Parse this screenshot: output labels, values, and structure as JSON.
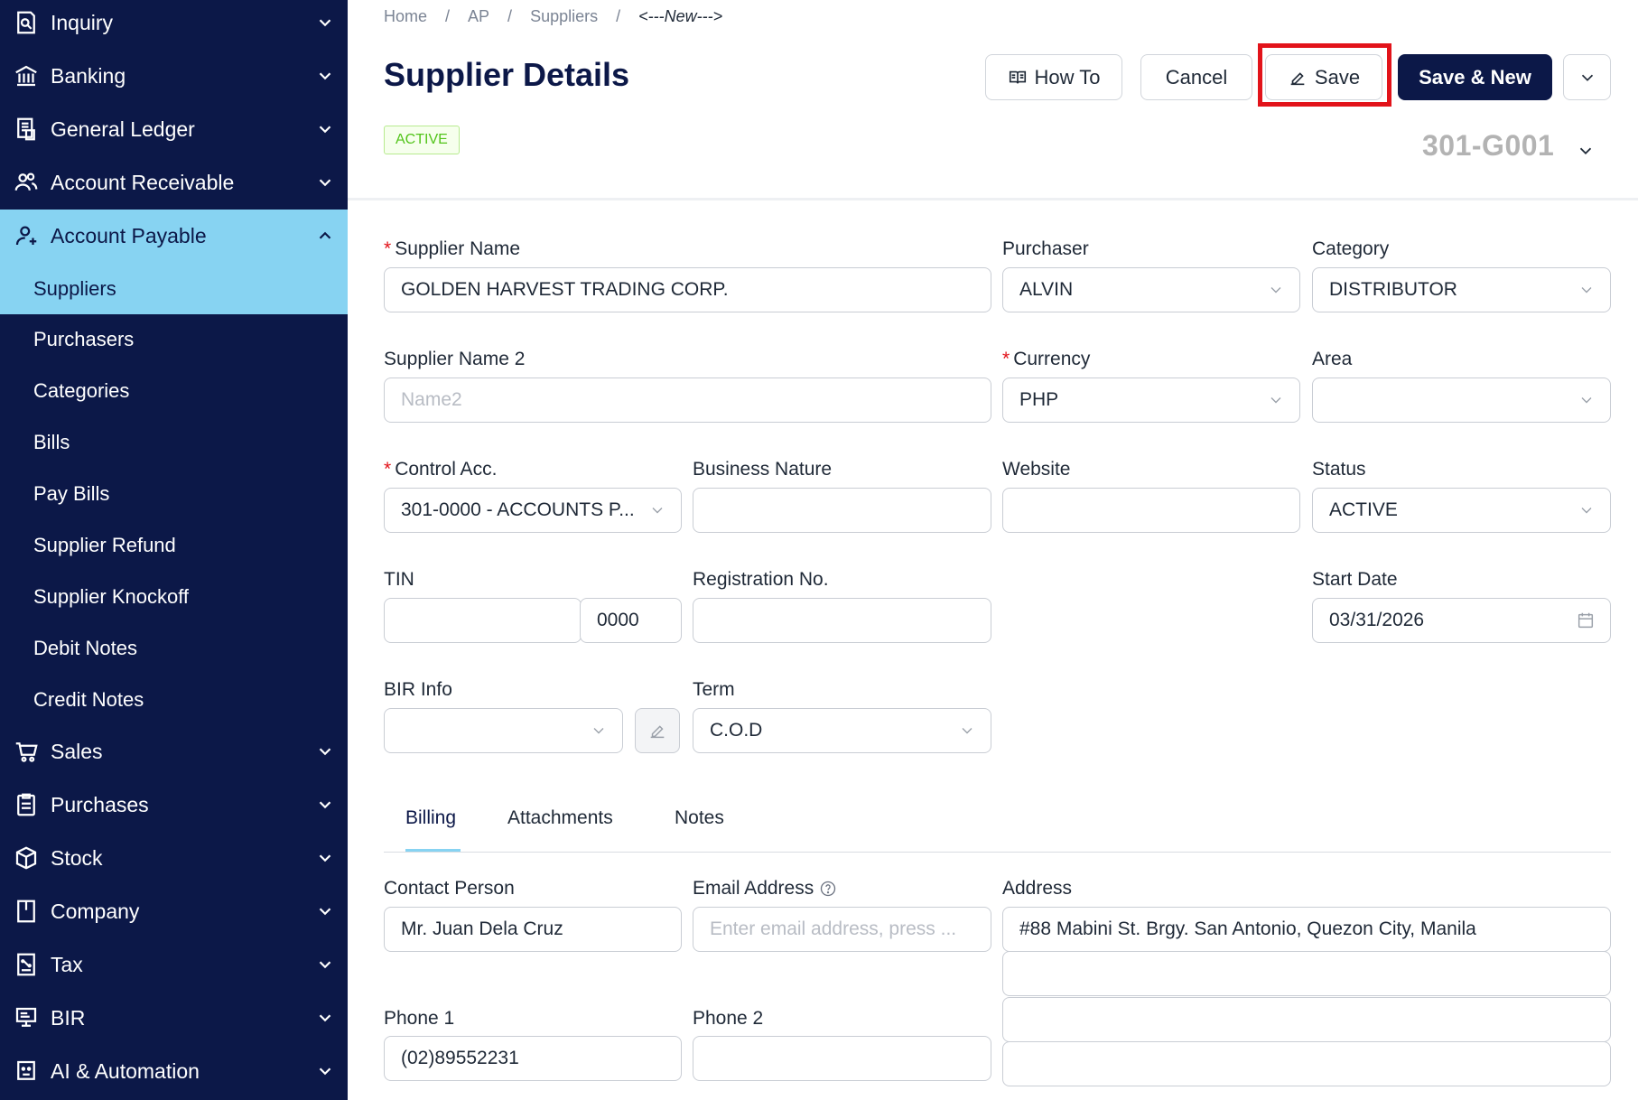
{
  "sidebar": {
    "inquiry": "Inquiry",
    "banking": "Banking",
    "general_ledger": "General Ledger",
    "account_receivable": "Account Receivable",
    "account_payable": "Account Payable",
    "sub": {
      "suppliers": "Suppliers",
      "purchasers": "Purchasers",
      "categories": "Categories",
      "bills": "Bills",
      "pay_bills": "Pay Bills",
      "supplier_refund": "Supplier Refund",
      "supplier_knockoff": "Supplier Knockoff",
      "debit_notes": "Debit Notes",
      "credit_notes": "Credit Notes"
    },
    "sales": "Sales",
    "purchases": "Purchases",
    "stock": "Stock",
    "company": "Company",
    "tax": "Tax",
    "bir": "BIR",
    "ai_automation": "AI & Automation"
  },
  "breadcrumb": {
    "home": "Home",
    "ap": "AP",
    "suppliers": "Suppliers",
    "current": "<---New--->",
    "sep": "/"
  },
  "header": {
    "title": "Supplier Details",
    "status_badge": "ACTIVE",
    "doc_no": "301-G001",
    "how_to": "How To",
    "cancel": "Cancel",
    "save": "Save",
    "save_new": "Save & New"
  },
  "form": {
    "supplier_name": {
      "label": "Supplier Name",
      "value": "GOLDEN HARVEST TRADING CORP."
    },
    "purchaser": {
      "label": "Purchaser",
      "value": "ALVIN"
    },
    "category": {
      "label": "Category",
      "value": "DISTRIBUTOR"
    },
    "supplier_name2": {
      "label": "Supplier Name 2",
      "placeholder": "Name2"
    },
    "currency": {
      "label": "Currency",
      "value": "PHP"
    },
    "area": {
      "label": "Area",
      "value": ""
    },
    "control_acc": {
      "label": "Control Acc.",
      "value": "301-0000 - ACCOUNTS P..."
    },
    "business_nature": {
      "label": "Business Nature",
      "value": ""
    },
    "website": {
      "label": "Website",
      "value": ""
    },
    "status": {
      "label": "Status",
      "value": "ACTIVE"
    },
    "tin": {
      "label": "TIN",
      "value": "",
      "branch": "0000"
    },
    "registration_no": {
      "label": "Registration No.",
      "value": ""
    },
    "start_date": {
      "label": "Start Date",
      "value": "03/31/2026"
    },
    "bir_info": {
      "label": "BIR Info",
      "value": ""
    },
    "term": {
      "label": "Term",
      "value": "C.O.D"
    }
  },
  "tabs": {
    "billing": "Billing",
    "attachments": "Attachments",
    "notes": "Notes"
  },
  "billing": {
    "contact_person": {
      "label": "Contact Person",
      "value": "Mr. Juan Dela Cruz"
    },
    "email": {
      "label": "Email Address",
      "placeholder": "Enter email address, press ..."
    },
    "address": {
      "label": "Address",
      "line1": "#88 Mabini St. Brgy. San Antonio, Quezon City, Manila",
      "line2": "",
      "line3": "",
      "line4": ""
    },
    "phone1": {
      "label": "Phone 1",
      "value": "(02)89552231"
    },
    "phone2": {
      "label": "Phone 2",
      "value": ""
    }
  }
}
